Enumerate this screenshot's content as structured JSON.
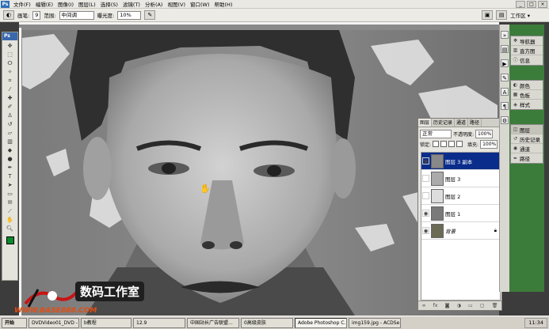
{
  "menubar": {
    "app_badge": "Ps",
    "items": [
      "文件(F)",
      "编辑(E)",
      "图像(I)",
      "图层(L)",
      "选择(S)",
      "滤镜(T)",
      "分析(A)",
      "视图(V)",
      "窗口(W)",
      "帮助(H)"
    ],
    "window_buttons": [
      "_",
      "□",
      "×"
    ]
  },
  "options": {
    "brush_label": "画笔:",
    "brush_size": "9",
    "range_label": "范围:",
    "range_value": "中间调",
    "exposure_label": "曝光度:",
    "exposure_value": "10%",
    "workspace_label": "工作区 ▾"
  },
  "toolbox": {
    "badge": "Ps"
  },
  "watermark": {
    "studio_name": "数码工作室",
    "url": "WWW.BASE888.COM"
  },
  "layers_panel": {
    "tabs": [
      "图层",
      "历史记录",
      "通道",
      "路径"
    ],
    "blend_mode": "正常",
    "opacity_label": "不透明度:",
    "opacity_value": "100%",
    "lock_label": "锁定:",
    "fill_label": "填充:",
    "fill_value": "100%",
    "layers": [
      {
        "name": "图层 3 副本",
        "visible": true,
        "selected": true
      },
      {
        "name": "图层 3",
        "visible": false,
        "selected": false
      },
      {
        "name": "图层 2",
        "visible": false,
        "selected": false
      },
      {
        "name": "图层 1",
        "visible": true,
        "selected": false
      },
      {
        "name": "背景",
        "visible": true,
        "selected": false,
        "locked": true
      }
    ]
  },
  "dock": {
    "groups": [
      [
        "导航器",
        "直方图",
        "信息"
      ],
      [
        "颜色",
        "色板",
        "样式"
      ],
      [
        "图层",
        "历史记录",
        "通道",
        "路径"
      ]
    ]
  },
  "taskbar": {
    "start": "开始",
    "buttons": [
      "DVDVideo01_DVD - N...",
      "b教程",
      "12.9",
      "中国站长广告联盟...",
      "0高级皮肤",
      "Adobe Photoshop C...",
      "img159.jpg - ACDSe..."
    ],
    "clock": "11:34"
  }
}
